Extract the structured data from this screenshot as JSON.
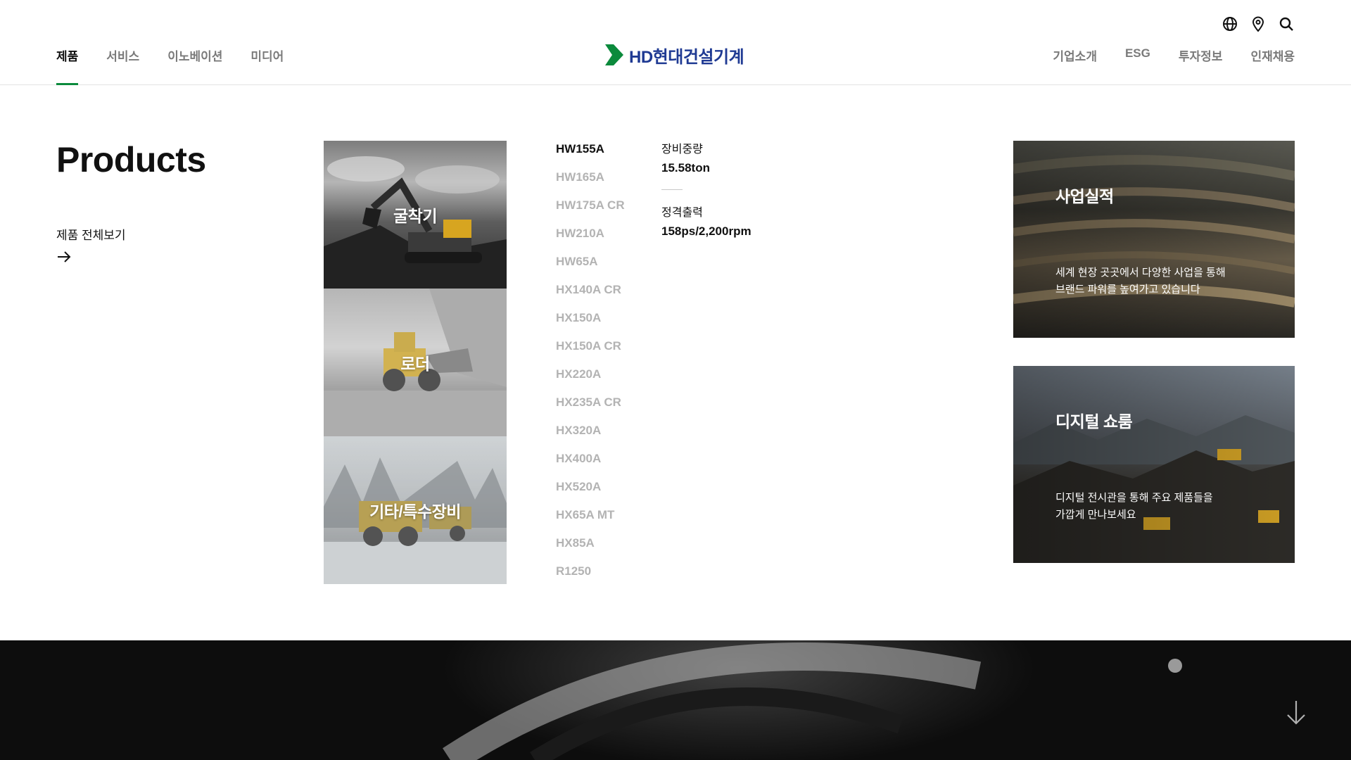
{
  "header": {
    "nav_left": [
      {
        "label": "제품",
        "active": true
      },
      {
        "label": "서비스",
        "active": false
      },
      {
        "label": "이노베이션",
        "active": false
      },
      {
        "label": "미디어",
        "active": false
      }
    ],
    "logo_text": "HD현대건설기계",
    "nav_right": [
      {
        "label": "기업소개"
      },
      {
        "label": "ESG"
      },
      {
        "label": "투자정보"
      },
      {
        "label": "인재채용"
      }
    ],
    "utility_icons": [
      "globe-icon",
      "location-pin-icon",
      "search-icon"
    ],
    "accent_color": "#0b8a3c",
    "logo_color": "#1f3a93"
  },
  "products": {
    "title": "Products",
    "view_all": "제품 전체보기"
  },
  "categories": [
    {
      "label": "굴착기"
    },
    {
      "label": "로더"
    },
    {
      "label": "기타/특수장비"
    }
  ],
  "models": [
    "HW155A",
    "HW165A",
    "HW175A CR",
    "HW210A",
    "HW65A",
    "HX140A CR",
    "HX150A",
    "HX150A CR",
    "HX220A",
    "HX235A CR",
    "HX320A",
    "HX400A",
    "HX520A",
    "HX65A MT",
    "HX85A",
    "R1250"
  ],
  "active_model": "HW155A",
  "specs": {
    "weight_label": "장비중량",
    "weight_value": "15.58ton",
    "power_label": "정격출력",
    "power_value": "158ps/2,200rpm"
  },
  "cards": [
    {
      "title": "사업실적",
      "desc_line1": "세계 현장 곳곳에서 다양한 사업을 통해",
      "desc_line2": "브랜드 파워를 높여가고 있습니다"
    },
    {
      "title": "디지털 쇼룸",
      "desc_line1": "디지털 전시관을 통해 주요 제품들을",
      "desc_line2": "가깝게 만나보세요"
    }
  ]
}
